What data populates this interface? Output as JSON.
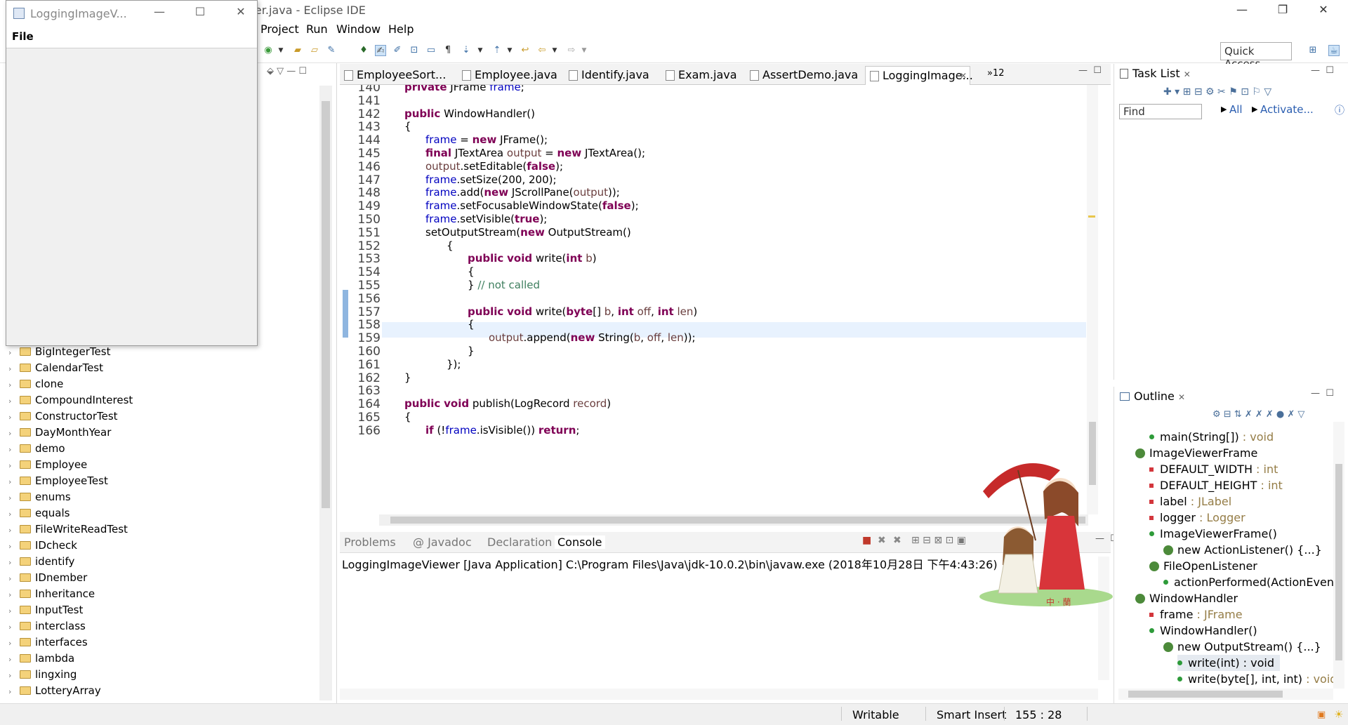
{
  "window": {
    "title": "LoggingImageViewer/src/LoggingImageViewer.java - Eclipse IDE",
    "title_visible": "ewer.java - Eclipse IDE",
    "minimize": "—",
    "restore": "❐",
    "close": "✕"
  },
  "menubar": [
    "Project",
    "Run",
    "Window",
    "Help"
  ],
  "quick_access": "Quick Access",
  "floating_window": {
    "title": "LoggingImageV...",
    "menu": "File",
    "minimize": "—",
    "maximize": "☐",
    "close": "✕"
  },
  "package_explorer": {
    "items": [
      "BigIntegerTest",
      "CalendarTest",
      "clone",
      "CompoundInterest",
      "ConstructorTest",
      "DayMonthYear",
      "demo",
      "Employee",
      "EmployeeTest",
      "enums",
      "equals",
      "FileWriteReadTest",
      "IDcheck",
      "identify",
      "IDnember",
      "Inheritance",
      "InputTest",
      "interclass",
      "interfaces",
      "lambda",
      "lingxing",
      "LotteryArray"
    ]
  },
  "editor": {
    "tabs": [
      "EmployeeSort...",
      "Employee.java",
      "Identify.java",
      "Exam.java",
      "AssertDemo.java",
      "LoggingImage..."
    ],
    "active_tab": "LoggingImage...",
    "overflow": "»12",
    "lines": [
      {
        "n": "140",
        "code": "private JFrame frame;"
      },
      {
        "n": "141",
        "code": ""
      },
      {
        "n": "142",
        "code": "public WindowHandler()"
      },
      {
        "n": "143",
        "code": "{"
      },
      {
        "n": "144",
        "code": "frame = new JFrame();"
      },
      {
        "n": "145",
        "code": "final JTextArea output = new JTextArea();"
      },
      {
        "n": "146",
        "code": "output.setEditable(false);"
      },
      {
        "n": "147",
        "code": "frame.setSize(200, 200);"
      },
      {
        "n": "148",
        "code": "frame.add(new JScrollPane(output));"
      },
      {
        "n": "149",
        "code": "frame.setFocusableWindowState(false);"
      },
      {
        "n": "150",
        "code": "frame.setVisible(true);"
      },
      {
        "n": "151",
        "code": "setOutputStream(new OutputStream()"
      },
      {
        "n": "152",
        "code": "{"
      },
      {
        "n": "153",
        "code": "public void write(int b)"
      },
      {
        "n": "154",
        "code": "{"
      },
      {
        "n": "155",
        "code": "} // not called"
      },
      {
        "n": "156",
        "code": ""
      },
      {
        "n": "157",
        "code": "public void write(byte[] b, int off, int len)"
      },
      {
        "n": "158",
        "code": "{"
      },
      {
        "n": "159",
        "code": "output.append(new String(b, off, len));"
      },
      {
        "n": "160",
        "code": "}"
      },
      {
        "n": "161",
        "code": "});"
      },
      {
        "n": "162",
        "code": "}"
      },
      {
        "n": "163",
        "code": ""
      },
      {
        "n": "164",
        "code": "public void publish(LogRecord record)"
      },
      {
        "n": "165",
        "code": "{"
      },
      {
        "n": "166",
        "code": "if (!frame.isVisible()) return;"
      }
    ]
  },
  "bottom": {
    "tabs": [
      "Problems",
      "@ Javadoc",
      "Declaration",
      "Console"
    ],
    "active_tab": "Console",
    "console_line": "LoggingImageViewer [Java Application] C:\\Program Files\\Java\\jdk-10.0.2\\bin\\javaw.exe (2018年10月28日 下午4:43:26)"
  },
  "task_list": {
    "title": "Task List",
    "find_placeholder": "Find",
    "all": "All",
    "activate": "Activate..."
  },
  "outline": {
    "title": "Outline",
    "items": [
      {
        "label": "main(String[])",
        "type": " : void"
      },
      {
        "label": "ImageViewerFrame",
        "type": ""
      },
      {
        "label": "DEFAULT_WIDTH",
        "type": " : int"
      },
      {
        "label": "DEFAULT_HEIGHT",
        "type": " : int"
      },
      {
        "label": "label",
        "type": " : JLabel"
      },
      {
        "label": "logger",
        "type": " : Logger"
      },
      {
        "label": "ImageViewerFrame()",
        "type": ""
      },
      {
        "label": "new ActionListener() {...}",
        "type": ""
      },
      {
        "label": "FileOpenListener",
        "type": ""
      },
      {
        "label": "actionPerformed(ActionEvent",
        "type": ""
      },
      {
        "label": "WindowHandler",
        "type": ""
      },
      {
        "label": "frame",
        "type": " : JFrame"
      },
      {
        "label": "WindowHandler()",
        "type": ""
      },
      {
        "label": "new OutputStream() {...}",
        "type": ""
      },
      {
        "label": "write(int) : void",
        "type": ""
      },
      {
        "label": "write(byte[], int, int)",
        "type": " : void"
      }
    ]
  },
  "status": {
    "writable": "Writable",
    "insert_mode": "Smart Insert",
    "position": "155 : 28"
  },
  "colors": {
    "keyword": "#7f0055",
    "field": "#0000c0",
    "comment": "#3f7f5f",
    "current_line": "#e8f2fe"
  }
}
